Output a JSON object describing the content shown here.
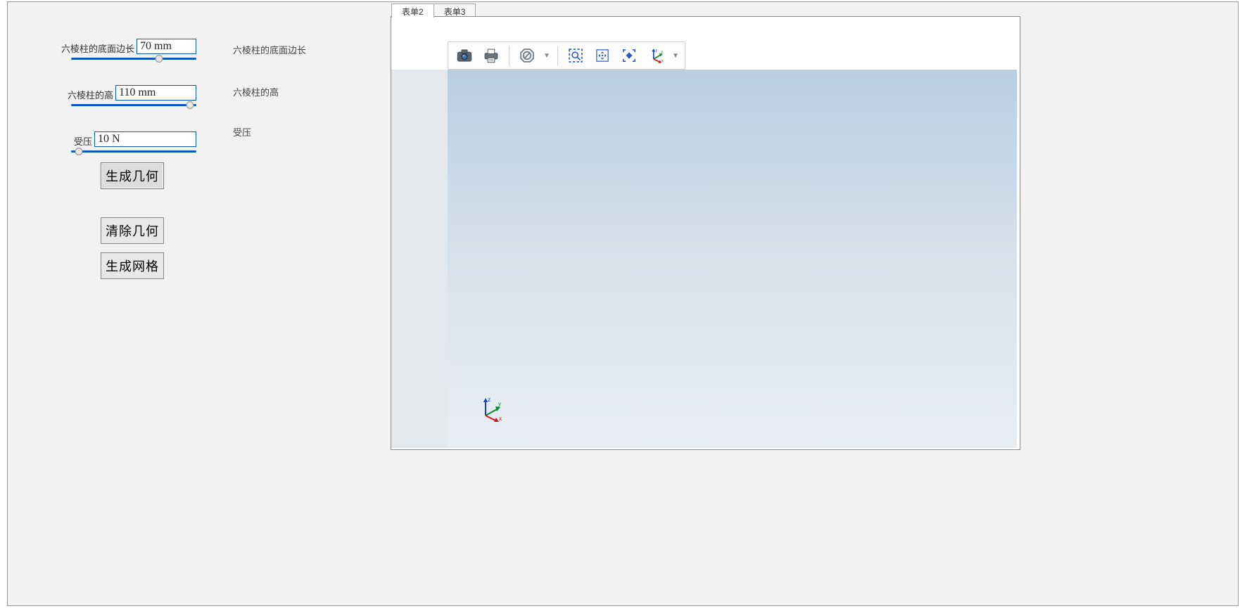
{
  "tabs": [
    {
      "label": "表单2",
      "active": true
    },
    {
      "label": "表单3",
      "active": false
    }
  ],
  "params": {
    "base_edge": {
      "label": "六棱柱的底面边长",
      "value": "70 mm",
      "echo": "六棱柱的底面边长",
      "slider_pct": 70
    },
    "height": {
      "label": "六棱柱的高",
      "value": "110 mm",
      "echo": "六棱柱的高",
      "slider_pct": 95
    },
    "pressure": {
      "label": "受压",
      "value": "10 N",
      "echo": "受压",
      "slider_pct": 6
    }
  },
  "buttons": {
    "generate_geom": "生成几何",
    "clear_geom": "清除几何",
    "generate_mesh": "生成网格"
  },
  "toolbar": {
    "camera": "camera-icon",
    "print": "print-icon",
    "nosel": "no-entry-icon",
    "zoombox": "zoom-box-icon",
    "pan": "pan-icon",
    "fit": "fit-icon",
    "axes": "axes-icon"
  }
}
